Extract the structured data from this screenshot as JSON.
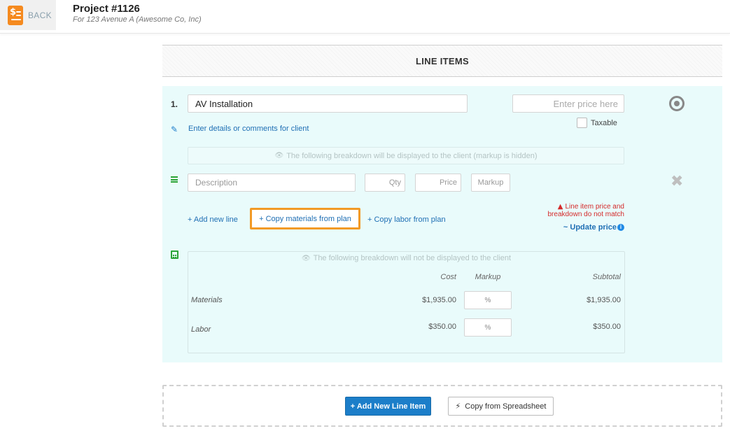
{
  "header": {
    "back_label": "BACK",
    "project_title": "Project #1126",
    "project_subtitle": "For 123 Avenue A (Awesome Co, Inc)"
  },
  "section": {
    "heading": "LINE ITEMS"
  },
  "line_item": {
    "number": "1.",
    "name_value": "AV Installation",
    "price_placeholder": "Enter price here",
    "taxable_label": "Taxable",
    "details_link": "Enter details or comments for client",
    "client_notice": "The following breakdown will be displayed to the client (markup is hidden)",
    "breakdown": {
      "description_placeholder": "Description",
      "qty_placeholder": "Qty",
      "price_placeholder": "Price",
      "markup_placeholder": "Markup"
    },
    "actions": {
      "add_new_line": "+ Add new line",
      "copy_materials": "+ Copy materials from plan",
      "copy_labor": "+ Copy labor from plan"
    },
    "warning": "Line item price and breakdown do not match",
    "update_price": "~ Update price",
    "cost_breakdown": {
      "notice": "The following breakdown will not be displayed to the client",
      "columns": {
        "cost": "Cost",
        "markup": "Markup",
        "subtotal": "Subtotal"
      },
      "rows": [
        {
          "label": "Materials",
          "cost": "$1,935.00",
          "markup_placeholder": "%",
          "subtotal": "$1,935.00"
        },
        {
          "label": "Labor",
          "cost": "$350.00",
          "markup_placeholder": "%",
          "subtotal": "$350.00"
        }
      ]
    }
  },
  "footer": {
    "add_line_item": "+ Add New Line Item",
    "copy_spreadsheet": "Copy from Spreadsheet"
  },
  "colors": {
    "accent_blue": "#1c7ec9",
    "card_bg": "#e9fbfb",
    "highlight_orange": "#f29a26",
    "warning_red": "#d42a2a",
    "icon_green": "#2ba336",
    "back_icon_orange": "#f58a1f"
  },
  "icons": {
    "back": "invoice-icon",
    "edit": "edit-icon",
    "breakdown": "list-icon",
    "calculator": "calculator-icon",
    "remove": "close-icon",
    "options": "target-icon",
    "eye": "eye-icon",
    "warning": "warning-icon",
    "info": "info-icon",
    "bolt": "bolt-icon"
  }
}
